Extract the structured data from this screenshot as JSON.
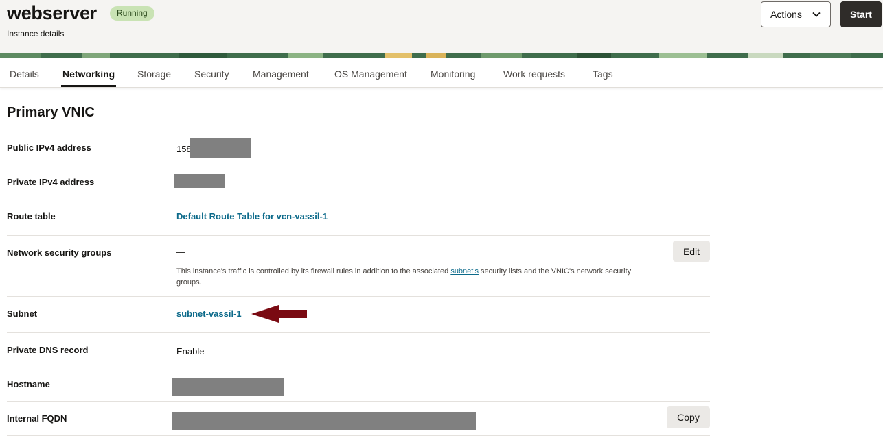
{
  "header": {
    "title": "webserver",
    "status": "Running",
    "subtitle": "Instance details",
    "actions_label": "Actions",
    "start_label": "Start"
  },
  "tabs": [
    {
      "label": "Details"
    },
    {
      "label": "Networking",
      "active": true
    },
    {
      "label": "Storage"
    },
    {
      "label": "Security"
    },
    {
      "label": "Management"
    },
    {
      "label": "OS Management"
    },
    {
      "label": "Monitoring"
    },
    {
      "label": "Work requests"
    },
    {
      "label": "Tags"
    }
  ],
  "section": {
    "title": "Primary VNIC"
  },
  "fields": {
    "public_ip": {
      "label": "Public IPv4 address",
      "value_visible": "158"
    },
    "private_ip": {
      "label": "Private IPv4 address"
    },
    "route_table": {
      "label": "Route table",
      "value": "Default Route Table for vcn-vassil-1"
    },
    "nsg": {
      "label": "Network security groups",
      "value": "—",
      "edit_label": "Edit",
      "note_before": "This instance's traffic is controlled by its firewall rules in addition to the associated ",
      "note_link": "subnet's",
      "note_after": " security lists and the VNIC's network security groups."
    },
    "subnet": {
      "label": "Subnet",
      "value": "subnet-vassil-1"
    },
    "private_dns": {
      "label": "Private DNS record",
      "value": "Enable"
    },
    "hostname": {
      "label": "Hostname"
    },
    "fqdn": {
      "label": "Internal FQDN",
      "copy_label": "Copy"
    }
  },
  "colors": {
    "link": "#0c6a8a",
    "status_badge_bg": "#c9e3b4",
    "arrow": "#7a0a12",
    "redaction": "#808080"
  },
  "icons": {
    "actions_dropdown": "chevron-down-icon",
    "annotation": "red-arrow-icon"
  }
}
